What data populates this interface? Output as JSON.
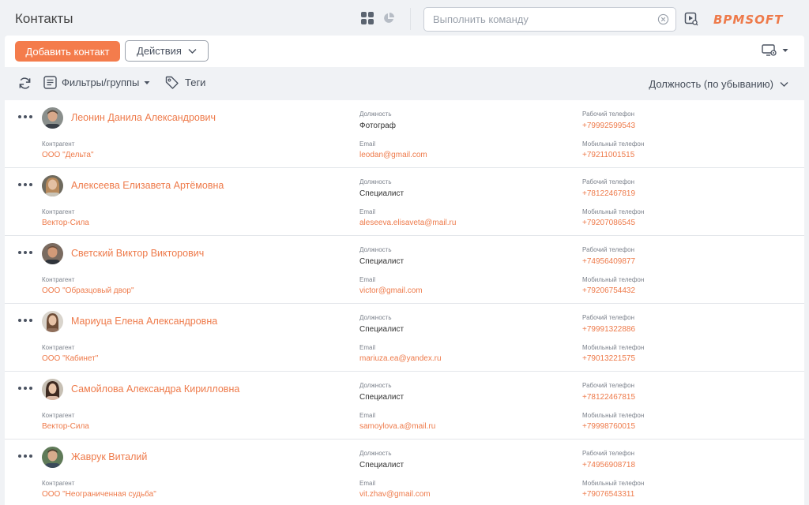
{
  "header": {
    "title": "Контакты",
    "search_placeholder": "Выполнить команду",
    "logo": "BPMSOFT",
    "accent": "#f47c4c"
  },
  "toolbar": {
    "add_label": "Добавить контакт",
    "actions_label": "Действия"
  },
  "filters": {
    "filters_label": "Фильтры/группы",
    "tags_label": "Теги",
    "sort_label": "Должность (по убыванию)"
  },
  "labels": {
    "position": "Должность",
    "account": "Контрагент",
    "email": "Email",
    "work_phone": "Рабочий телефон",
    "mobile_phone": "Мобильный телефон"
  },
  "contacts": [
    {
      "name": "Леонин Данила Александрович",
      "position": "Фотограф",
      "account": "ООО \"Дельта\"",
      "email": "leodan@gmail.com",
      "work_phone": "+79992599543",
      "mobile_phone": "+79211001515"
    },
    {
      "name": "Алексеева Елизавета Артёмовна",
      "position": "Специалист",
      "account": "Вектор-Сила",
      "email": "aleseeva.elisaveta@mail.ru",
      "work_phone": "+78122467819",
      "mobile_phone": "+79207086545"
    },
    {
      "name": "Светский Виктор Викторович",
      "position": "Специалист",
      "account": "ООО \"Образцовый двор\"",
      "email": "victor@gmail.com",
      "work_phone": "+74956409877",
      "mobile_phone": "+79206754432"
    },
    {
      "name": "Мариуца Елена Александровна",
      "position": "Специалист",
      "account": "ООО \"Кабинет\"",
      "email": "mariuza.ea@yandex.ru",
      "work_phone": "+79991322886",
      "mobile_phone": "+79013221575"
    },
    {
      "name": "Самойлова Александра Кирилловна",
      "position": "Специалист",
      "account": "Вектор-Сила",
      "email": "samoylova.a@mail.ru",
      "work_phone": "+78122467815",
      "mobile_phone": "+79998760015"
    },
    {
      "name": "Жаврук Виталий",
      "position": "Специалист",
      "account": "ООО \"Неограниченная судьба\"",
      "email": "vit.zhav@gmail.com",
      "work_phone": "+74956908718",
      "mobile_phone": "+79076543311"
    }
  ]
}
